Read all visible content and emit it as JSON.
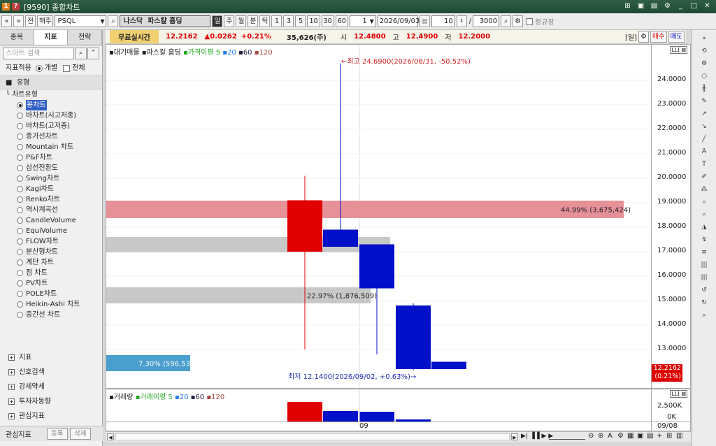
{
  "window": {
    "title": "[9590] 종합차트",
    "badge1": "1",
    "badge2": "?",
    "btn_min": "_",
    "btn_max": "□",
    "btn_close": "✕",
    "btn_gear": "⚙",
    "btn_pin": "⊞",
    "btn_a": "▣",
    "btn_b": "▤"
  },
  "toolbar": {
    "nav_prev2": "«",
    "nav_prev": "»",
    "tab_jeon": "전",
    "tab_haeju": "해주",
    "symbol": "PSQL",
    "market": "나스닥",
    "name": "파스칼 홈딩",
    "periods": [
      "일",
      "주",
      "월",
      "분",
      "틱"
    ],
    "minutes": [
      "1",
      "3",
      "5",
      "10",
      "30",
      "60"
    ],
    "count_unit": "1",
    "date": "2026/09/03",
    "view_count": "10",
    "slash": "/",
    "total": "3000",
    "fixed_label": "정규장"
  },
  "left": {
    "tabs": [
      "종목",
      "지표",
      "전략"
    ],
    "search_placeholder": "스마트 검색",
    "apply_label": "지표적용",
    "opt_individual": "개별",
    "opt_all": "전체",
    "section": "유형",
    "tree_root": "차트유형",
    "chart_types": [
      "봉차트",
      "바차트(시고저종)",
      "바차트(고저종)",
      "종가선차트",
      "Mountain 차트",
      "P&F차트",
      "삼선전환도",
      "Swing차트",
      "Kagi차트",
      "Renko차트",
      "역시계곡선",
      "CandleVolume",
      "EquiVolume",
      "FLOW차트",
      "분산형차트",
      "계단 차트",
      "점 차트",
      "PV차트",
      "POLE차트",
      "Heikin-Ashi 차트",
      "중간선 차트"
    ],
    "groups": [
      "지표",
      "신호검색",
      "강세약세",
      "투자자동향",
      "관심지표"
    ],
    "bottom_label": "관심지표",
    "btn_register": "등록",
    "btn_delete": "삭제"
  },
  "info": {
    "realtime": "무료실시간",
    "price": "12.2162",
    "change": "▲0.0262",
    "pct": "+0.21%",
    "volume": "35,626(주)",
    "open_label": "시",
    "open": "12.4800",
    "high_label": "고",
    "high": "12.4900",
    "low_label": "저",
    "low": "12.2000",
    "period_tag": "[일]",
    "buy": "매수",
    "sell": "매도"
  },
  "chart": {
    "legend": {
      "type": "대기매물",
      "name": "파스칼 홈딩",
      "ma_label": "가격이평",
      "ma": [
        "5",
        "20",
        "60",
        "120"
      ]
    },
    "y_ticks": [
      "24.0000",
      "23.0000",
      "22.0000",
      "21.0000",
      "20.0000",
      "19.0000",
      "18.0000",
      "17.0000",
      "16.0000",
      "15.0000",
      "14.0000",
      "13.0000"
    ],
    "high_note": "←최고 24.6900(2026/08/31, -50.52%)",
    "low_note": "최저 12.1400(2026/09/02, +0.63%)→",
    "zone_labels": [
      "44.99% (3,675,424)",
      "22.97% (1,876,509)",
      "7.30% (596,535)"
    ],
    "current_price": "12.2162",
    "current_pct": "(0.21%)"
  },
  "chart_data": {
    "type": "candlestick",
    "candles": [
      {
        "open": 19.1,
        "high": 20.1,
        "low": 13.0,
        "close": 17.0,
        "color": "#e00000"
      },
      {
        "open": 17.9,
        "high": 24.69,
        "low": 17.7,
        "close": 17.2,
        "color": "#0010c8"
      },
      {
        "open": 17.3,
        "high": 17.3,
        "low": 12.8,
        "close": 15.5,
        "color": "#0010c8"
      },
      {
        "open": 14.8,
        "high": 14.9,
        "low": 12.14,
        "close": 12.2,
        "color": "#0010c8"
      },
      {
        "open": 12.5,
        "high": 12.5,
        "low": 12.2,
        "close": 12.2,
        "color": "#0010c8"
      }
    ],
    "price_zones": [
      {
        "pct": "44.99%",
        "volume": 3675424
      },
      {
        "pct": "22.97%",
        "volume": 1876509
      },
      {
        "pct": "7.30%",
        "volume": 596535
      }
    ],
    "x_label": "09",
    "volume_ticks": [
      "2,500K",
      "0K"
    ]
  },
  "volume": {
    "legend_type": "거래량",
    "ma_label": "거래이평",
    "ma": [
      "5",
      "20",
      "60",
      "120"
    ],
    "ticks": [
      "2,500K",
      "0K"
    ]
  },
  "xaxis": {
    "label": "09",
    "right_date": "09/08"
  }
}
